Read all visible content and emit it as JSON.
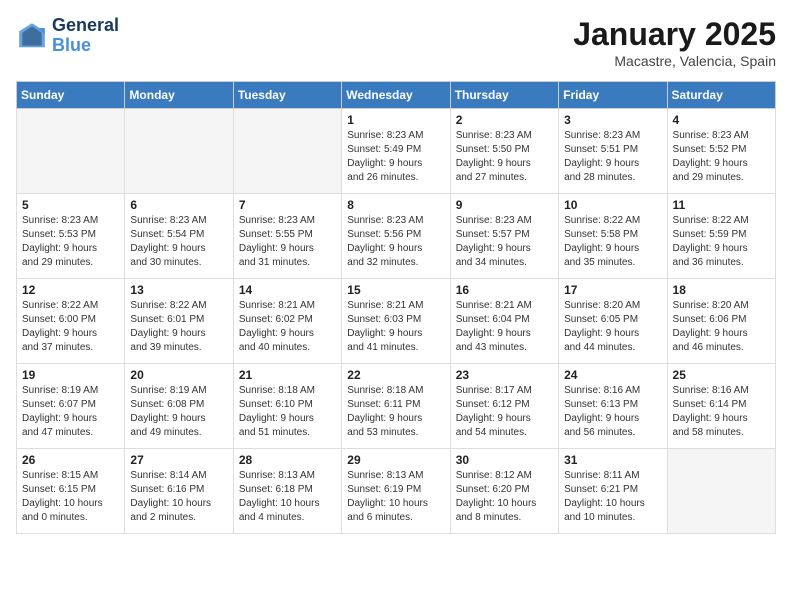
{
  "header": {
    "logo_line1": "General",
    "logo_line2": "Blue",
    "month": "January 2025",
    "location": "Macastre, Valencia, Spain"
  },
  "weekdays": [
    "Sunday",
    "Monday",
    "Tuesday",
    "Wednesday",
    "Thursday",
    "Friday",
    "Saturday"
  ],
  "weeks": [
    [
      {
        "day": "",
        "info": ""
      },
      {
        "day": "",
        "info": ""
      },
      {
        "day": "",
        "info": ""
      },
      {
        "day": "1",
        "info": "Sunrise: 8:23 AM\nSunset: 5:49 PM\nDaylight: 9 hours\nand 26 minutes."
      },
      {
        "day": "2",
        "info": "Sunrise: 8:23 AM\nSunset: 5:50 PM\nDaylight: 9 hours\nand 27 minutes."
      },
      {
        "day": "3",
        "info": "Sunrise: 8:23 AM\nSunset: 5:51 PM\nDaylight: 9 hours\nand 28 minutes."
      },
      {
        "day": "4",
        "info": "Sunrise: 8:23 AM\nSunset: 5:52 PM\nDaylight: 9 hours\nand 29 minutes."
      }
    ],
    [
      {
        "day": "5",
        "info": "Sunrise: 8:23 AM\nSunset: 5:53 PM\nDaylight: 9 hours\nand 29 minutes."
      },
      {
        "day": "6",
        "info": "Sunrise: 8:23 AM\nSunset: 5:54 PM\nDaylight: 9 hours\nand 30 minutes."
      },
      {
        "day": "7",
        "info": "Sunrise: 8:23 AM\nSunset: 5:55 PM\nDaylight: 9 hours\nand 31 minutes."
      },
      {
        "day": "8",
        "info": "Sunrise: 8:23 AM\nSunset: 5:56 PM\nDaylight: 9 hours\nand 32 minutes."
      },
      {
        "day": "9",
        "info": "Sunrise: 8:23 AM\nSunset: 5:57 PM\nDaylight: 9 hours\nand 34 minutes."
      },
      {
        "day": "10",
        "info": "Sunrise: 8:22 AM\nSunset: 5:58 PM\nDaylight: 9 hours\nand 35 minutes."
      },
      {
        "day": "11",
        "info": "Sunrise: 8:22 AM\nSunset: 5:59 PM\nDaylight: 9 hours\nand 36 minutes."
      }
    ],
    [
      {
        "day": "12",
        "info": "Sunrise: 8:22 AM\nSunset: 6:00 PM\nDaylight: 9 hours\nand 37 minutes."
      },
      {
        "day": "13",
        "info": "Sunrise: 8:22 AM\nSunset: 6:01 PM\nDaylight: 9 hours\nand 39 minutes."
      },
      {
        "day": "14",
        "info": "Sunrise: 8:21 AM\nSunset: 6:02 PM\nDaylight: 9 hours\nand 40 minutes."
      },
      {
        "day": "15",
        "info": "Sunrise: 8:21 AM\nSunset: 6:03 PM\nDaylight: 9 hours\nand 41 minutes."
      },
      {
        "day": "16",
        "info": "Sunrise: 8:21 AM\nSunset: 6:04 PM\nDaylight: 9 hours\nand 43 minutes."
      },
      {
        "day": "17",
        "info": "Sunrise: 8:20 AM\nSunset: 6:05 PM\nDaylight: 9 hours\nand 44 minutes."
      },
      {
        "day": "18",
        "info": "Sunrise: 8:20 AM\nSunset: 6:06 PM\nDaylight: 9 hours\nand 46 minutes."
      }
    ],
    [
      {
        "day": "19",
        "info": "Sunrise: 8:19 AM\nSunset: 6:07 PM\nDaylight: 9 hours\nand 47 minutes."
      },
      {
        "day": "20",
        "info": "Sunrise: 8:19 AM\nSunset: 6:08 PM\nDaylight: 9 hours\nand 49 minutes."
      },
      {
        "day": "21",
        "info": "Sunrise: 8:18 AM\nSunset: 6:10 PM\nDaylight: 9 hours\nand 51 minutes."
      },
      {
        "day": "22",
        "info": "Sunrise: 8:18 AM\nSunset: 6:11 PM\nDaylight: 9 hours\nand 53 minutes."
      },
      {
        "day": "23",
        "info": "Sunrise: 8:17 AM\nSunset: 6:12 PM\nDaylight: 9 hours\nand 54 minutes."
      },
      {
        "day": "24",
        "info": "Sunrise: 8:16 AM\nSunset: 6:13 PM\nDaylight: 9 hours\nand 56 minutes."
      },
      {
        "day": "25",
        "info": "Sunrise: 8:16 AM\nSunset: 6:14 PM\nDaylight: 9 hours\nand 58 minutes."
      }
    ],
    [
      {
        "day": "26",
        "info": "Sunrise: 8:15 AM\nSunset: 6:15 PM\nDaylight: 10 hours\nand 0 minutes."
      },
      {
        "day": "27",
        "info": "Sunrise: 8:14 AM\nSunset: 6:16 PM\nDaylight: 10 hours\nand 2 minutes."
      },
      {
        "day": "28",
        "info": "Sunrise: 8:13 AM\nSunset: 6:18 PM\nDaylight: 10 hours\nand 4 minutes."
      },
      {
        "day": "29",
        "info": "Sunrise: 8:13 AM\nSunset: 6:19 PM\nDaylight: 10 hours\nand 6 minutes."
      },
      {
        "day": "30",
        "info": "Sunrise: 8:12 AM\nSunset: 6:20 PM\nDaylight: 10 hours\nand 8 minutes."
      },
      {
        "day": "31",
        "info": "Sunrise: 8:11 AM\nSunset: 6:21 PM\nDaylight: 10 hours\nand 10 minutes."
      },
      {
        "day": "",
        "info": ""
      }
    ]
  ]
}
